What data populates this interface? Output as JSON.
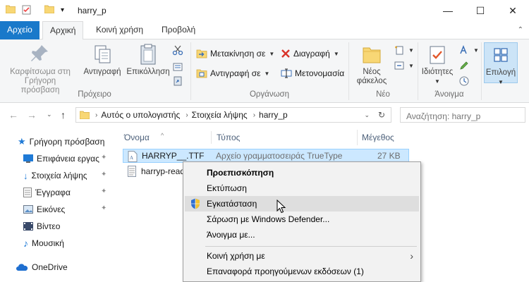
{
  "window": {
    "title": "harry_p",
    "min_glyph": "—",
    "max_glyph": "☐",
    "close_glyph": "✕"
  },
  "tabs": [
    {
      "label": "Αρχείο"
    },
    {
      "label": "Αρχική"
    },
    {
      "label": "Κοινή χρήση"
    },
    {
      "label": "Προβολή"
    }
  ],
  "ribbon": {
    "clipboard": {
      "pin_label_1": "Καρφίτσωμα στη",
      "pin_label_2": "Γρήγορη πρόσβαση",
      "copy_label": "Αντιγραφή",
      "paste_label": "Επικόλληση",
      "group_label": "Πρόχειρο"
    },
    "organize": {
      "move_label": "Μετακίνηση σε",
      "copy_to_label": "Αντιγραφή σε",
      "delete_label": "Διαγραφή",
      "rename_label": "Μετονομασία",
      "group_label": "Οργάνωση"
    },
    "new": {
      "folder_label_1": "Νέος",
      "folder_label_2": "φάκελος",
      "group_label": "Νέο"
    },
    "open": {
      "properties_label": "Ιδιότητες",
      "group_label": "Άνοιγμα"
    },
    "select": {
      "select_label": "Επιλογή"
    }
  },
  "address": {
    "crumbs": [
      "Αυτός ο υπολογιστής",
      "Στοιχεία λήψης",
      "harry_p"
    ],
    "search_placeholder": "Αναζήτηση: harry_p"
  },
  "navpane": {
    "items": [
      {
        "label": "Γρήγορη πρόσβαση"
      },
      {
        "label": "Επιφάνεια εργας"
      },
      {
        "label": "Στοιχεία λήψης"
      },
      {
        "label": "Έγγραφα"
      },
      {
        "label": "Εικόνες"
      },
      {
        "label": "Βίντεο"
      },
      {
        "label": "Μουσική"
      },
      {
        "label": "OneDrive"
      }
    ]
  },
  "filelist": {
    "columns": {
      "name": "Όνομα",
      "type": "Τύπος",
      "size": "Μέγεθος"
    },
    "rows": [
      {
        "name": "HARRYP__.TTF",
        "type": "Αρχείο γραμματοσειράς TrueType",
        "size": "27 KB"
      },
      {
        "name": "harryp-read",
        "type": "",
        "size": ""
      }
    ]
  },
  "context_menu": {
    "items": [
      {
        "label": "Προεπισκόπηση"
      },
      {
        "label": "Εκτύπωση"
      },
      {
        "label": "Εγκατάσταση"
      },
      {
        "label": "Σάρωση με Windows Defender..."
      },
      {
        "label": "Άνοιγμα με..."
      },
      {
        "label": "Κοινή χρήση με"
      },
      {
        "label": "Επαναφορά προηγούμενων εκδόσεων (1)"
      }
    ]
  },
  "colors": {
    "accent": "#1979ca",
    "selection": "#cce8ff",
    "menu_bg": "#f2f2f2",
    "folder": "#f8d775"
  }
}
